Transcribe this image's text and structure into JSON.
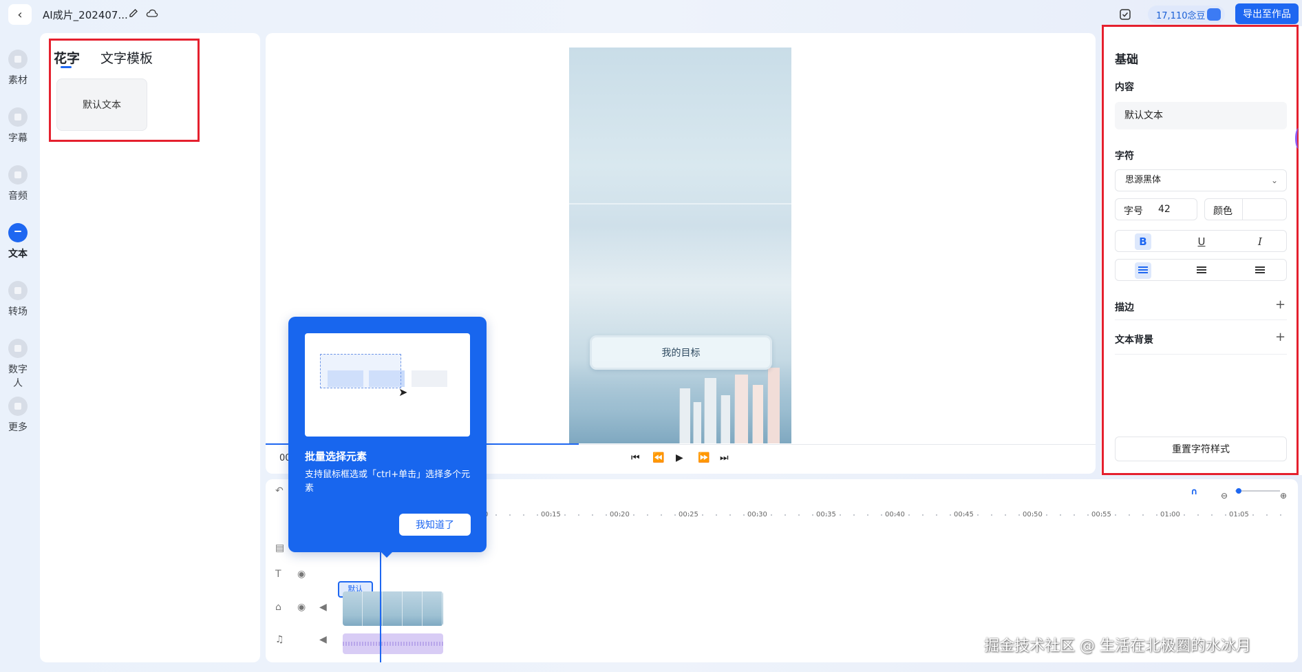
{
  "header": {
    "back_icon": "chevron-left-icon",
    "project_title": "AI成片_202407...",
    "beans": "17,110念豆",
    "export_label": "导出至作品"
  },
  "sidebar": {
    "items": [
      {
        "label": "素材",
        "icon": "material-icon"
      },
      {
        "label": "字幕",
        "icon": "subtitle-icon"
      },
      {
        "label": "音频",
        "icon": "music-icon"
      },
      {
        "label": "文本",
        "icon": "text-icon"
      },
      {
        "label": "转场",
        "icon": "transition-icon"
      },
      {
        "label": "数字人",
        "icon": "avatar-icon"
      },
      {
        "label": "更多",
        "icon": "more-icon"
      }
    ],
    "active": "文本"
  },
  "library": {
    "tabs": [
      "花字",
      "文字模板"
    ],
    "active_tab": "花字",
    "preset_label": "默认文本"
  },
  "preview": {
    "overlay_text": "我的目标",
    "time_partial": "00"
  },
  "tooltip": {
    "title": "批量选择元素",
    "description": "支持鼠标框选或「ctrl+单击」选择多个元素",
    "confirm": "我知道了"
  },
  "timeline": {
    "ruler": [
      "0",
      "00:15",
      "00:20",
      "00:25",
      "00:30",
      "00:35",
      "00:40",
      "00:45",
      "00:50",
      "00:55",
      "01:00",
      "01:05"
    ],
    "text_clip_label": "默认"
  },
  "properties": {
    "section_title": "基础",
    "content_label": "内容",
    "content_value": "默认文本",
    "char_label": "字符",
    "font_value": "思源黑体",
    "size_label": "字号",
    "size_value": "42",
    "color_label": "颜色",
    "bold": "B",
    "underline": "U",
    "italic": "I",
    "stroke_label": "描边",
    "bg_label": "文本背景",
    "reset_label": "重置字符样式"
  },
  "watermark": "掘金技术社区 @ 生活在北极圈的水冰月",
  "colors": {
    "accent": "#1e67f1",
    "annotation_red": "#e5202e"
  }
}
